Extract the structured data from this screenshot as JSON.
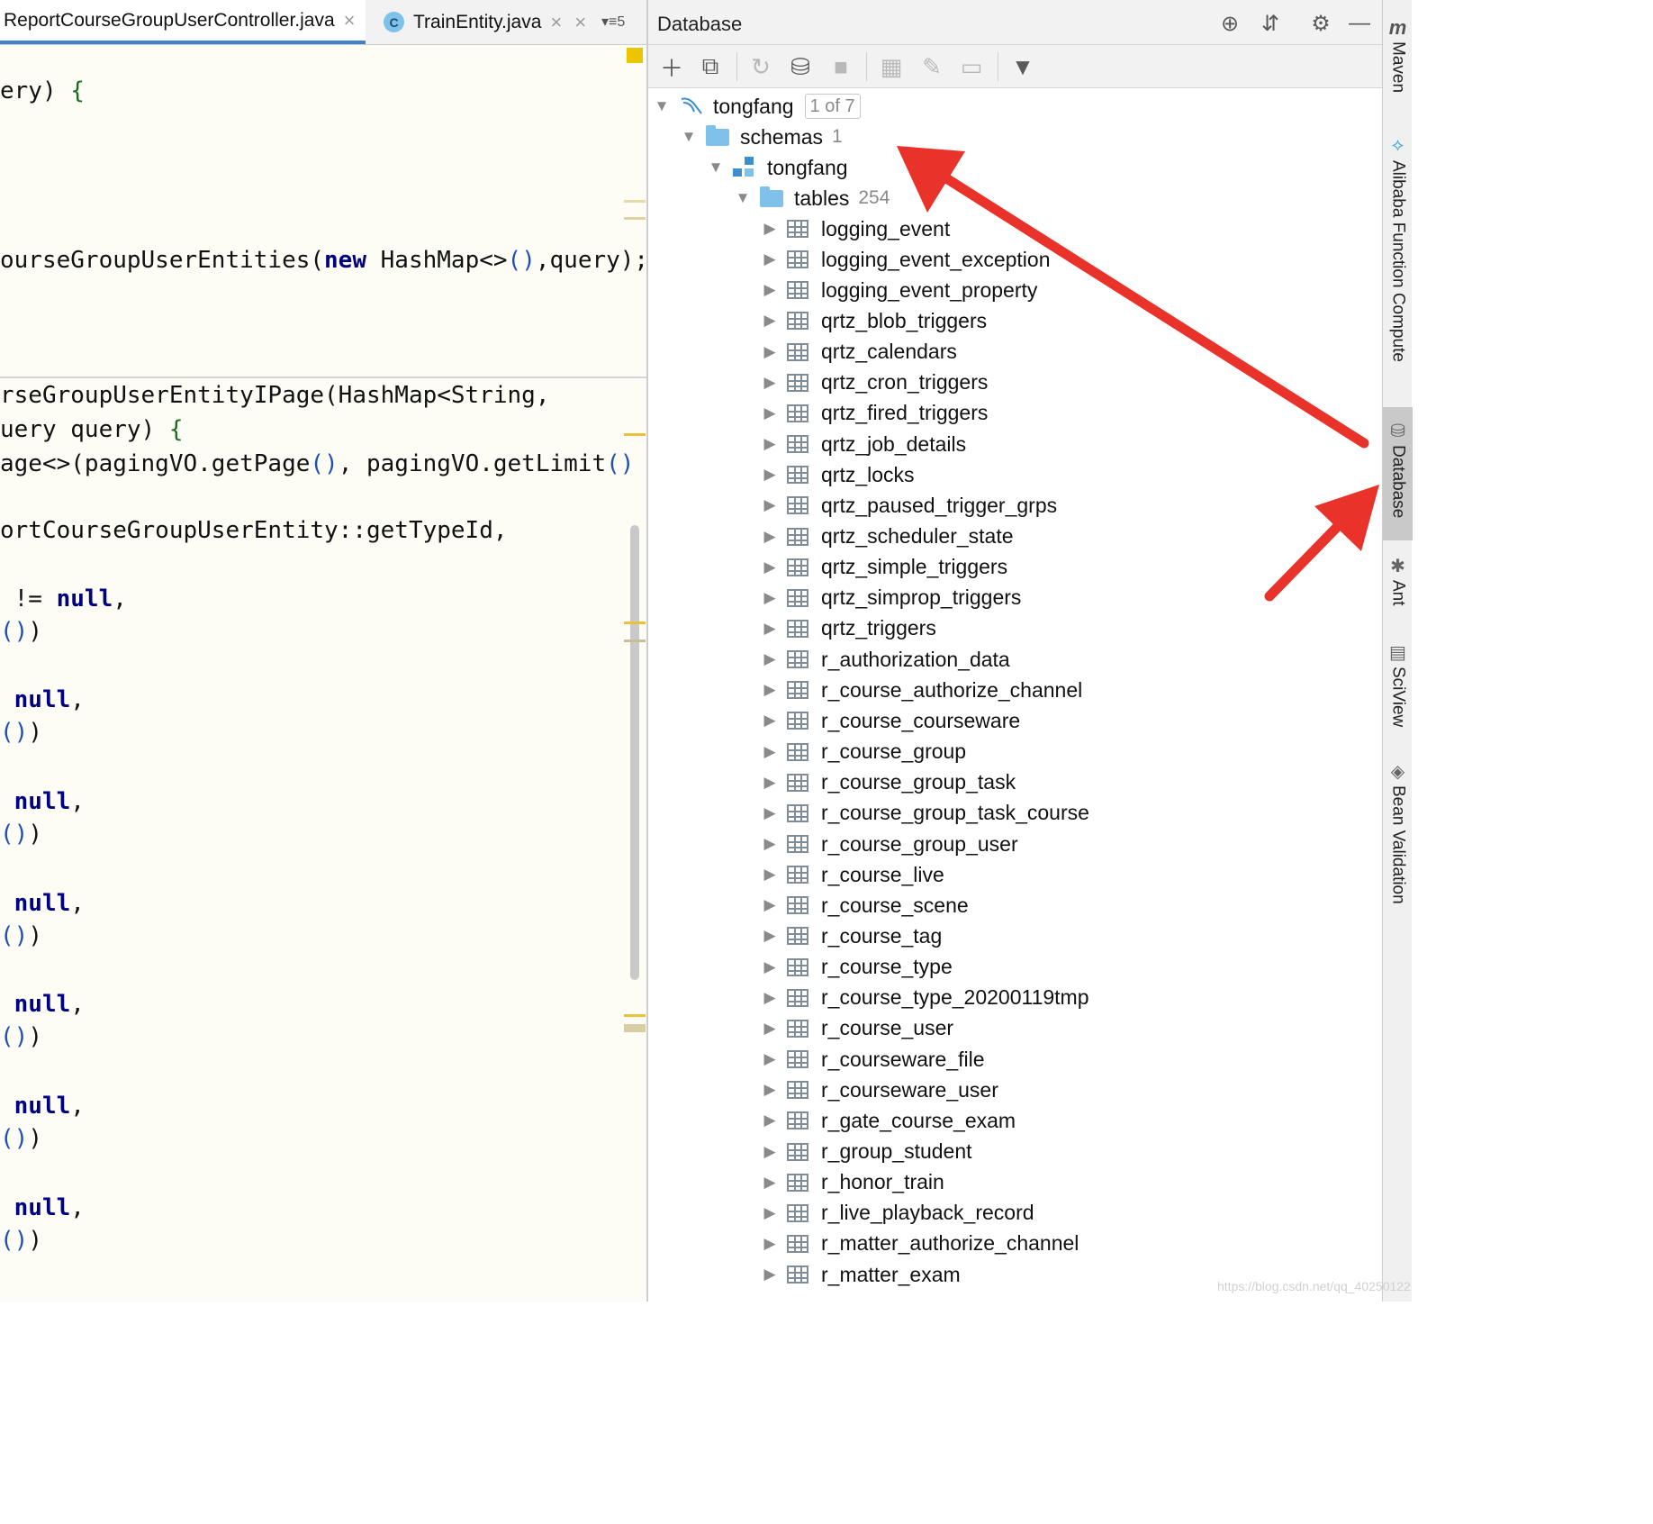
{
  "editor": {
    "tabs": [
      {
        "label": "ReportCourseGroupUserController.java",
        "close": "×"
      },
      {
        "label": "TrainEntity.java",
        "close": "×",
        "icon": "C"
      }
    ],
    "tab_overflow": "≡5",
    "code_lines": [
      "ery) {",
      "ourseGroupUserEntities(new HashMap<>(),query);",
      "rseGroupUserEntityIPage(HashMap<String,",
      "uery query) {",
      "age<>(pagingVO.getPage(), pagingVO.getLimit()",
      "ortCourseGroupUserEntity::getTypeId,",
      " != null,",
      "())",
      " null,",
      "())",
      " null,",
      "())",
      " null,",
      "())",
      " null,",
      "())",
      " null,",
      "())",
      " null,",
      "())"
    ]
  },
  "database": {
    "title": "Database",
    "datasource": {
      "name": "tongfang",
      "badge": "1 of 7"
    },
    "schemas": {
      "label": "schemas",
      "count": "1"
    },
    "schema": {
      "name": "tongfang"
    },
    "tables_node": {
      "label": "tables",
      "count": "254"
    },
    "tables": [
      "logging_event",
      "logging_event_exception",
      "logging_event_property",
      "qrtz_blob_triggers",
      "qrtz_calendars",
      "qrtz_cron_triggers",
      "qrtz_fired_triggers",
      "qrtz_job_details",
      "qrtz_locks",
      "qrtz_paused_trigger_grps",
      "qrtz_scheduler_state",
      "qrtz_simple_triggers",
      "qrtz_simprop_triggers",
      "qrtz_triggers",
      "r_authorization_data",
      "r_course_authorize_channel",
      "r_course_courseware",
      "r_course_group",
      "r_course_group_task",
      "r_course_group_task_course",
      "r_course_group_user",
      "r_course_live",
      "r_course_scene",
      "r_course_tag",
      "r_course_type",
      "r_course_type_20200119tmp",
      "r_course_user",
      "r_courseware_file",
      "r_courseware_user",
      "r_gate_course_exam",
      "r_group_student",
      "r_honor_train",
      "r_live_playback_record",
      "r_matter_authorize_channel",
      "r_matter_exam"
    ]
  },
  "tool_strip": [
    {
      "label": "Maven",
      "icon": "maven-icon"
    },
    {
      "label": "Alibaba Function Compute",
      "icon": "function-compute-icon"
    },
    {
      "label": "Database",
      "icon": "database-icon",
      "active": true
    },
    {
      "label": "Ant",
      "icon": "ant-icon"
    },
    {
      "label": "SciView",
      "icon": "sciview-icon"
    },
    {
      "label": "Bean Validation",
      "icon": "bean-validation-icon"
    }
  ],
  "watermark": "https://blog.csdn.net/qq_40250122",
  "colors": {
    "annotation_arrow": "#e8322a",
    "accent": "#4083c9",
    "folder": "#7fc1ea"
  }
}
